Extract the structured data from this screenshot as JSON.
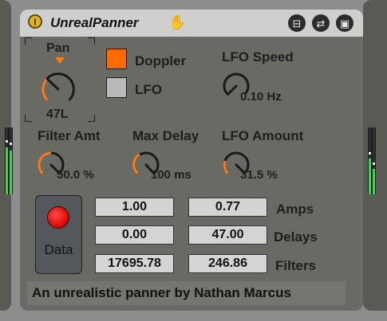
{
  "device": {
    "title": "UnrealPanner",
    "hand_icon": "hand-icon",
    "header_buttons": [
      {
        "icon": "unfold-icon",
        "glyph": "⊟"
      },
      {
        "icon": "hot-swap-icon",
        "glyph": "⇄"
      },
      {
        "icon": "save-icon",
        "glyph": "▣"
      }
    ]
  },
  "pan": {
    "label": "Pan",
    "value": "47L",
    "position": 0.47
  },
  "doppler": {
    "label": "Doppler",
    "on": true
  },
  "lfo": {
    "label": "LFO",
    "on": false
  },
  "lfo_speed": {
    "label": "LFO Speed",
    "value": "0.10 Hz"
  },
  "filter_amt": {
    "label": "Filter Amt",
    "value": "50.0 %"
  },
  "max_delay": {
    "label": "Max Delay",
    "value": "100 ms"
  },
  "lfo_amount": {
    "label": "LFO Amount",
    "value": "31.5 %"
  },
  "data_button": {
    "label": "Data",
    "led_on": true
  },
  "table": {
    "rows": [
      {
        "label": "Amps",
        "left": "1.00",
        "right": "0.77"
      },
      {
        "label": "Delays",
        "left": "0.00",
        "right": "47.00"
      },
      {
        "label": "Filters",
        "left": "17695.78",
        "right": "246.86"
      }
    ]
  },
  "info": "An unrealistic panner by Nathan Marcus",
  "colors": {
    "accent": "#ff7a1a",
    "device_bg": "#696a63",
    "title_bar": "#cfcfcf",
    "meter_green": "#49d15b",
    "led_red": "#e41010",
    "doppler_on": "#ff6a00",
    "toggle_off": "#b9b9b9"
  }
}
